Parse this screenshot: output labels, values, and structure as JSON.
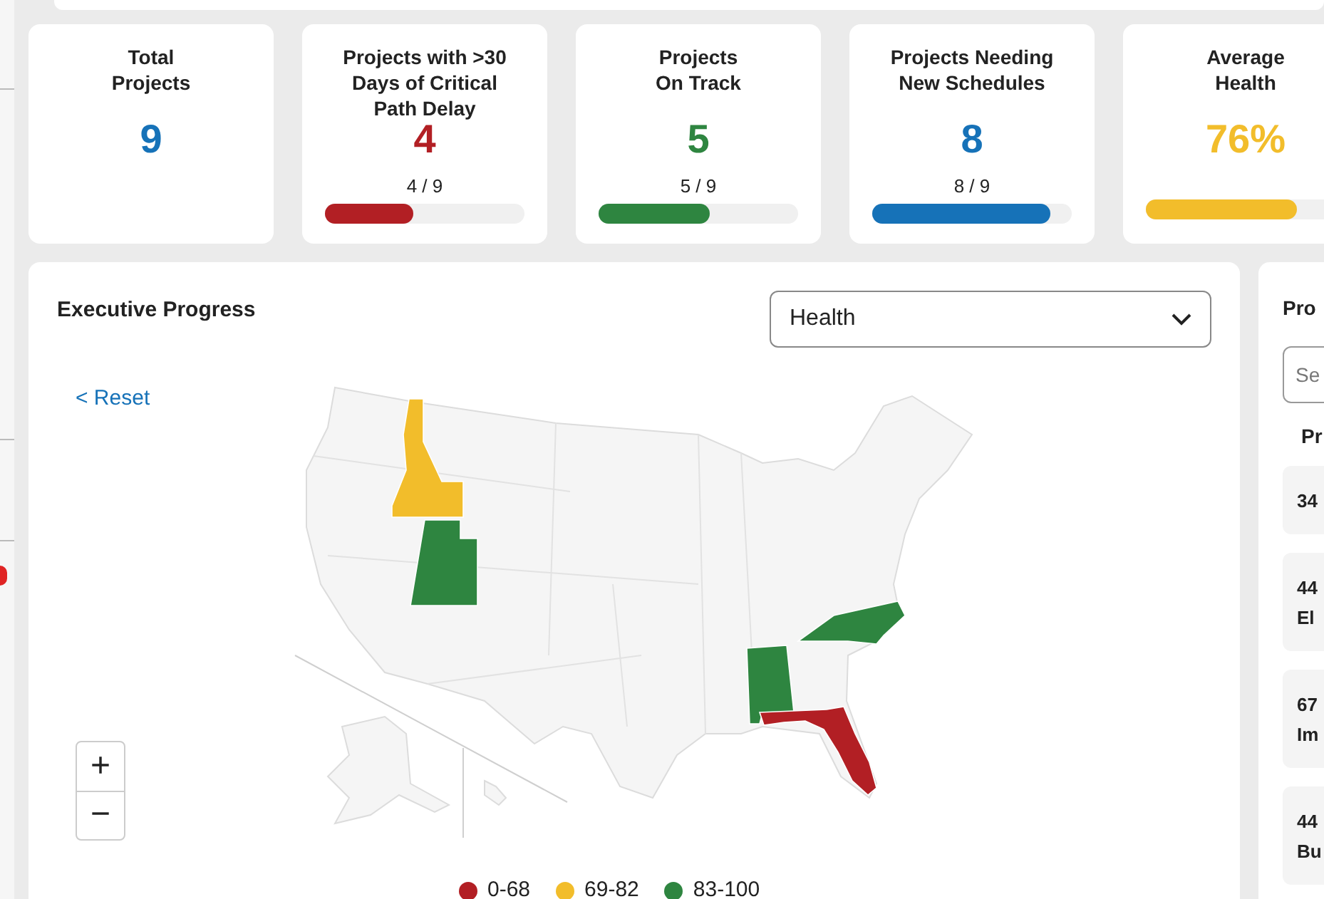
{
  "stats": [
    {
      "label": "Total\nProjects",
      "value": "9",
      "color": "#1672b8"
    },
    {
      "label": "Projects with >30\nDays of Critical\nPath Delay",
      "value": "4",
      "color": "#b21f24",
      "fraction": "4 / 9",
      "level": 0.44
    },
    {
      "label": "Projects\nOn Track",
      "value": "5",
      "color": "#2e8540",
      "fraction": "5 / 9",
      "level": 0.56
    },
    {
      "label": "Projects Needing\nNew Schedules",
      "value": "8",
      "color": "#1672b8",
      "fraction": "8 / 9",
      "level": 0.89
    },
    {
      "label": "Average\nHealth",
      "value": "76%",
      "color": "#f2bd2b",
      "level": 0.76
    }
  ],
  "map_panel": {
    "title": "Executive Progress",
    "dropdown": {
      "value": "Health"
    },
    "reset": "< Reset",
    "zoom_in": "+",
    "zoom_out": "−",
    "regions": [
      {
        "color": "#f2bd2b"
      },
      {
        "color": "#2e8540"
      },
      {
        "color": "#2e8540"
      },
      {
        "color": "#2e8540"
      },
      {
        "color": "#b21f24"
      }
    ],
    "legend": [
      {
        "label": "0-68",
        "color": "#b21f24"
      },
      {
        "label": "69-82",
        "color": "#f2bd2b"
      },
      {
        "label": "83-100",
        "color": "#2e8540"
      }
    ]
  },
  "projects_panel": {
    "title": "Pro",
    "search": {
      "placeholder": "Se"
    },
    "column": "Pr",
    "rows": [
      {
        "lines": [
          "34"
        ]
      },
      {
        "lines": [
          "44",
          "El"
        ]
      },
      {
        "lines": [
          "67",
          "Im"
        ]
      },
      {
        "lines": [
          "44",
          "Bu"
        ]
      }
    ]
  }
}
